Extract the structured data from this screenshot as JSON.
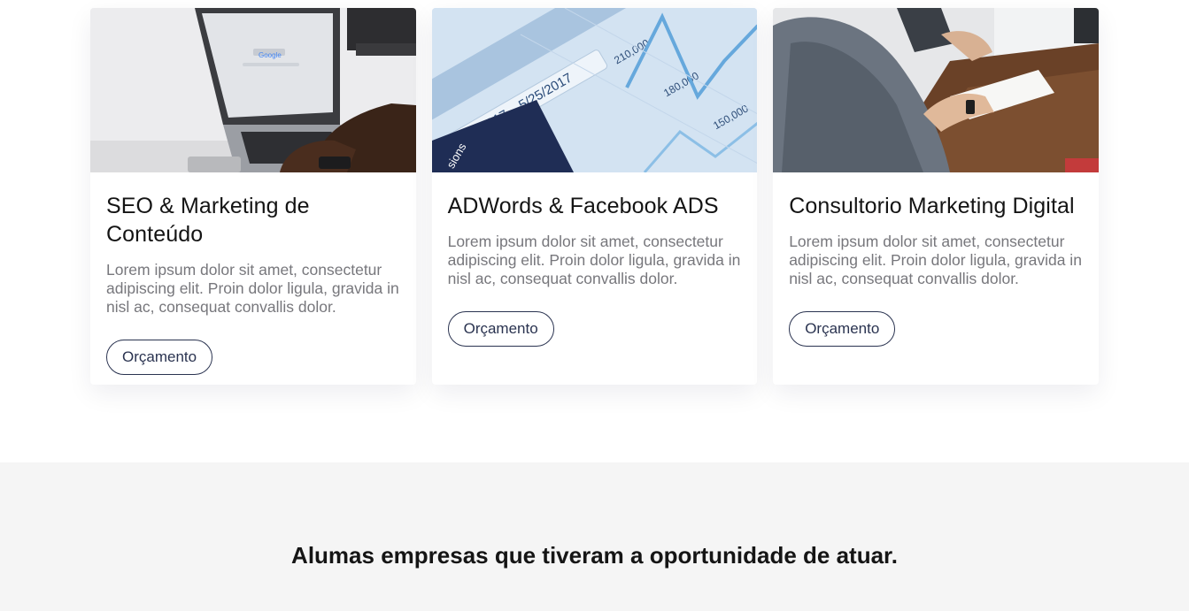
{
  "services": [
    {
      "title": "SEO & Marketing de Conteúdo",
      "text": "Lorem ipsum dolor sit amet, consectetur adipiscing elit. Proin dolor ligula, gravida in nisl ac, consequat convallis dolor.",
      "button": "Orçamento",
      "image": "laptop-photo"
    },
    {
      "title": "ADWords & Facebook ADS",
      "text": "Lorem ipsum dolor sit amet, consectetur adipiscing elit. Proin dolor ligula, gravida in nisl ac, consequat convallis dolor.",
      "button": "Orçamento",
      "image": "analytics-chart-photo",
      "image_text": {
        "date_range": "5/12/2017 – 5/25/2017",
        "ticks": [
          "210,000",
          "180,000",
          "150,000"
        ],
        "corner": "sions"
      }
    },
    {
      "title": "Consultorio Marketing Digital",
      "text": "Lorem ipsum dolor sit amet, consectetur adipiscing elit. Proin dolor ligula, gravida in nisl ac, consequat convallis dolor.",
      "button": "Orçamento",
      "image": "meeting-photo"
    }
  ],
  "clients": {
    "heading_before": "Alumas ",
    "heading_bold": "empresas",
    "heading_after": " que tiveram a oportunidade de atuar."
  },
  "colors": {
    "button_border": "#2a3350",
    "clients_bg": "#f5f5f5",
    "text_muted": "#77777c"
  }
}
